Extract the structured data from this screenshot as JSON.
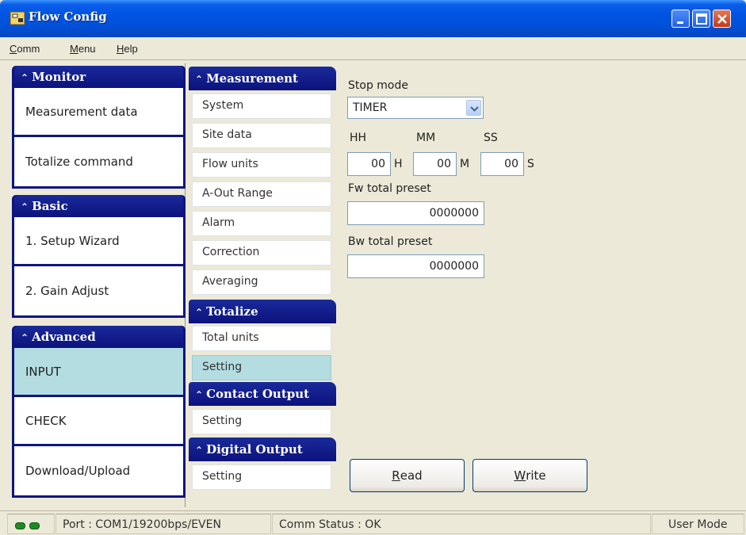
{
  "window": {
    "title": "Flow Config"
  },
  "menu": {
    "items": [
      {
        "label_u": "C",
        "label_rest": "omm"
      },
      {
        "label_u": "M",
        "label_rest": "enu"
      },
      {
        "label_u": "H",
        "label_rest": "elp"
      }
    ]
  },
  "left_nav": {
    "groups": [
      {
        "title": "Monitor",
        "items": [
          "Measurement data",
          "Totalize command"
        ]
      },
      {
        "title": "Basic",
        "items": [
          "1. Setup Wizard",
          "2. Gain Adjust"
        ]
      },
      {
        "title": "Advanced",
        "items": [
          "INPUT",
          "CHECK",
          "Download/Upload"
        ],
        "active_index": 0
      }
    ]
  },
  "mid_nav": {
    "sections": [
      {
        "title": "Measurement",
        "items": [
          "System",
          "Site data",
          "Flow units",
          "A-Out Range",
          "Alarm",
          "Correction",
          "Averaging"
        ]
      },
      {
        "title": "Totalize",
        "items": [
          "Total units",
          "Setting"
        ],
        "active_index": 1
      },
      {
        "title": "Contact Output",
        "items": [
          "Setting"
        ]
      },
      {
        "title": "Digital Output",
        "items": [
          "Setting"
        ]
      }
    ]
  },
  "form": {
    "stop_mode_label": "Stop mode",
    "stop_mode_value": "TIMER",
    "hh_label": "HH",
    "mm_label": "MM",
    "ss_label": "SS",
    "hh_value": "00",
    "mm_value": "00",
    "ss_value": "00",
    "h_unit": "H",
    "m_unit": "M",
    "s_unit": "S",
    "fw_label": "Fw total preset",
    "fw_value": "0000000",
    "bw_label": "Bw total preset",
    "bw_value": "0000000"
  },
  "buttons": {
    "read_u": "R",
    "read_rest": "ead",
    "write_u": "W",
    "write_rest": "rite"
  },
  "status": {
    "port": "Port : COM1/19200bps/EVEN",
    "comm": "Comm Status : OK",
    "mode": "User Mode"
  },
  "colors": {
    "nav_header": "#0c127d",
    "active_tile": "#b3dde1",
    "titlebar": "#0054e3"
  }
}
